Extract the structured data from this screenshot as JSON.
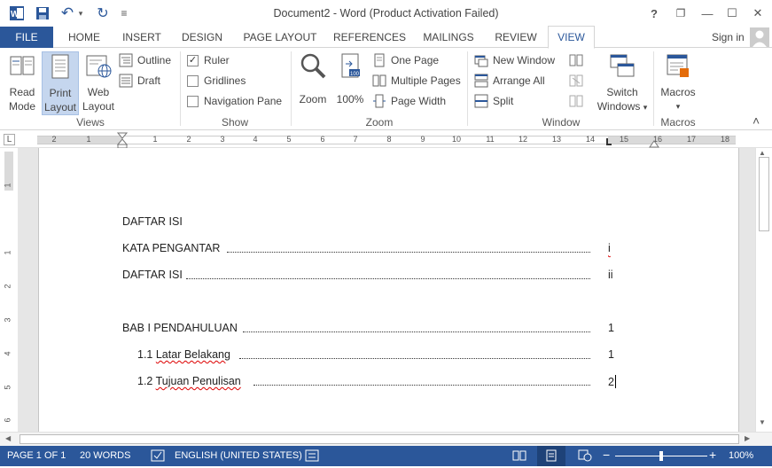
{
  "window": {
    "title": "Document2 - Word (Product Activation Failed)",
    "help": "?",
    "minimize_glyph": "—",
    "maximize_glyph": "☐",
    "close_glyph": "✕",
    "restore_glyph": "❐"
  },
  "qat": {
    "undo_glyph": "↶",
    "redo_glyph": "↻",
    "customize_glyph": "≡",
    "dropdown_glyph": "▾"
  },
  "tabs": {
    "file": "FILE",
    "items": [
      "HOME",
      "INSERT",
      "DESIGN",
      "PAGE LAYOUT",
      "REFERENCES",
      "MAILINGS",
      "REVIEW"
    ],
    "active": "VIEW",
    "signin": "Sign in"
  },
  "ribbon": {
    "views": {
      "read_mode": [
        "Read",
        "Mode"
      ],
      "print_layout": [
        "Print",
        "Layout"
      ],
      "web_layout": [
        "Web",
        "Layout"
      ],
      "outline": "Outline",
      "draft": "Draft",
      "label": "Views"
    },
    "show": {
      "ruler": "Ruler",
      "ruler_checked": "✓",
      "gridlines": "Gridlines",
      "navigation_pane": "Navigation Pane",
      "label": "Show"
    },
    "zoom": {
      "zoom": "Zoom",
      "hundred": "100%",
      "one_page": "One Page",
      "multiple_pages": "Multiple Pages",
      "page_width": "Page Width",
      "label": "Zoom"
    },
    "window": {
      "new_window": "New Window",
      "arrange_all": "Arrange All",
      "split": "Split",
      "switch_windows": [
        "Switch",
        "Windows"
      ],
      "dropdown_glyph": "▾",
      "label": "Window"
    },
    "macros": {
      "macros": "Macros",
      "dropdown_glyph": "▾",
      "label": "Macros"
    },
    "collapse_glyph": "˄"
  },
  "ruler": {
    "ticks": [
      "2",
      "1",
      "1",
      "2",
      "3",
      "4",
      "5",
      "6",
      "7",
      "8",
      "9",
      "10",
      "11",
      "12",
      "13",
      "14",
      "15",
      "16",
      "17",
      "18"
    ],
    "tab_selector": "L"
  },
  "vruler": {
    "ticks": [
      "1",
      "1",
      "2",
      "3",
      "4",
      "5",
      "6"
    ]
  },
  "document": {
    "lines": [
      {
        "text": "DAFTAR ISI",
        "page": ""
      },
      {
        "text": "KATA PENGANTAR",
        "page": "i"
      },
      {
        "text": "DAFTAR ISI",
        "page": "ii"
      },
      {
        "text": "BAB I PENDAHULUAN",
        "page": "1"
      },
      {
        "text_prefix": "1.1 ",
        "text_word": "Latar Belakang",
        "page": "1"
      },
      {
        "text_prefix": "1.2 ",
        "text_word": "Tujuan Penulisan",
        "page": "2"
      }
    ]
  },
  "scroll": {
    "up": "▲",
    "down": "▼",
    "left": "◀",
    "right": "▶"
  },
  "status": {
    "page": "PAGE 1 OF 1",
    "words": "20 WORDS",
    "language": "ENGLISH (UNITED STATES)",
    "zoom_minus": "−",
    "zoom_plus": "+",
    "zoom": "100%",
    "zoom_fraction": 0.5
  },
  "colors": {
    "accent": "#2b579a",
    "page_bg": "#e6e6e6"
  }
}
